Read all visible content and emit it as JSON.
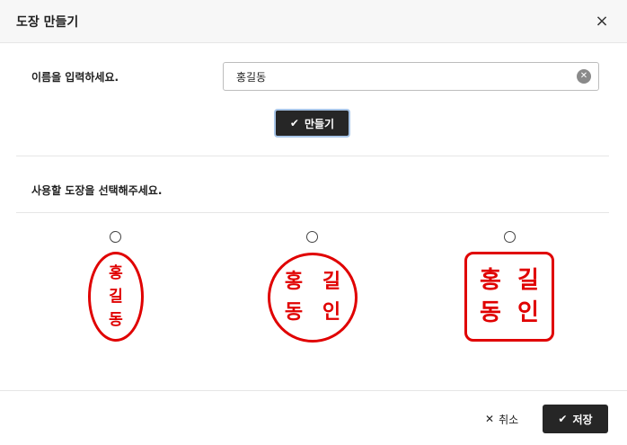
{
  "dialog": {
    "title": "도장 만들기",
    "close_icon": "×"
  },
  "name_section": {
    "label": "이름을 입력하세요.",
    "input_value": "홍길동",
    "clear_icon": "✕",
    "make_button_icon": "✔",
    "make_button_label": "만들기"
  },
  "select_section": {
    "label": "사용할 도장을 선택해주세요."
  },
  "seals": {
    "oval": {
      "chars": [
        "홍",
        "길",
        "동"
      ]
    },
    "circle": {
      "chars": [
        "홍",
        "길",
        "동",
        "인"
      ]
    },
    "square": {
      "chars": [
        "홍",
        "길",
        "동",
        "인"
      ]
    }
  },
  "footer": {
    "cancel_icon": "✕",
    "cancel_label": "취소",
    "save_icon": "✔",
    "save_label": "저장"
  },
  "colors": {
    "seal_red": "#e00000",
    "button_dark": "#262626"
  }
}
